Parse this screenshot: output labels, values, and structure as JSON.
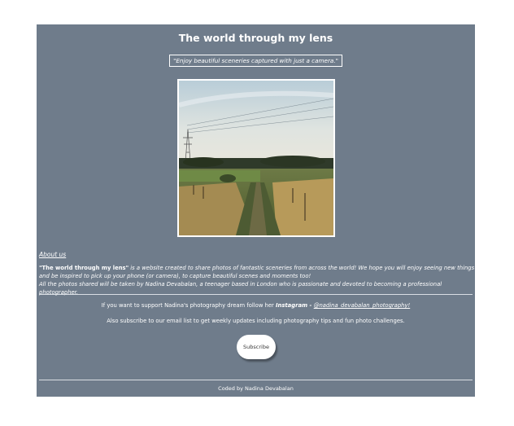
{
  "header": {
    "title": "The world through my lens",
    "tagline": "\"Enjoy beautiful sceneries captured with just a camera.\""
  },
  "about": {
    "heading": "About us",
    "site_name": "\"The world through my lens\"",
    "description_1": " is a website created to share photos of fantastic sceneries from across the world! We hope you will enjoy seeing new things and be inspired to pick up your phone (or camera), to capture beautiful scenes and moments too!",
    "description_2": "All the photos shared will be taken by Nadina Devabalan, a teenager based in London who is passionate and devoted to becoming a professional photographer."
  },
  "support": {
    "text": "If you want to support Nadina's photography dream follow her ",
    "instagram_label": "Instagram",
    "separator": " - ",
    "instagram_handle": "@nadina_devabalan_photography!"
  },
  "subscribe": {
    "note": "Also subscribe to our email list to get weekly updates including photography tips and fun photo challenges.",
    "button_label": "Subscribe"
  },
  "footer": {
    "credit": "Coded by Nadina Devabalan"
  },
  "colors": {
    "panel_bg": "#6f7c8b",
    "page_bg": "#ffffff",
    "text": "#ffffff"
  }
}
